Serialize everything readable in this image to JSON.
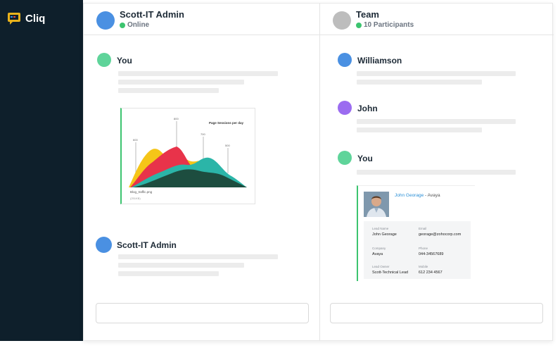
{
  "app": {
    "name": "Cliq"
  },
  "left_pane": {
    "header": {
      "title": "Scott-IT Admin",
      "status": "Online"
    },
    "messages": [
      {
        "sender": "You"
      },
      {
        "sender": "Scott-IT Admin"
      }
    ],
    "attachment": {
      "chart_title": "Page Sessions per day",
      "file_name": "Blog_traffic.png",
      "file_meta": "(251KB)",
      "peak_labels": [
        "600",
        "800",
        "700",
        "500"
      ]
    }
  },
  "right_pane": {
    "header": {
      "title": "Team",
      "status": "10 Participants"
    },
    "messages": [
      {
        "sender": "Williamson"
      },
      {
        "sender": "John"
      },
      {
        "sender": "You"
      }
    ],
    "lead_card": {
      "name": "John Georage",
      "company_suffix": "Avaya",
      "fields": [
        {
          "label": "Lead Name",
          "value": "John Georage"
        },
        {
          "label": "Email",
          "value": "georage@zohocorp.com"
        },
        {
          "label": "Company",
          "value": "Avaya"
        },
        {
          "label": "Phone",
          "value": "044-34567689"
        },
        {
          "label": "Lead Owner",
          "value": "Scott-Technical Lead"
        },
        {
          "label": "Mobile",
          "value": "612 234 4567"
        }
      ]
    }
  },
  "colors": {
    "sidebar": "#0e1f2b",
    "online": "#3cc46f",
    "avatar_blue": "#4a90e2",
    "avatar_gray": "#bdbdbd",
    "avatar_green": "#5fd49a",
    "avatar_purple": "#9b6cf0"
  },
  "icons": [
    "cliq-logo-icon",
    "online-dot-icon",
    "avatar-icon"
  ]
}
